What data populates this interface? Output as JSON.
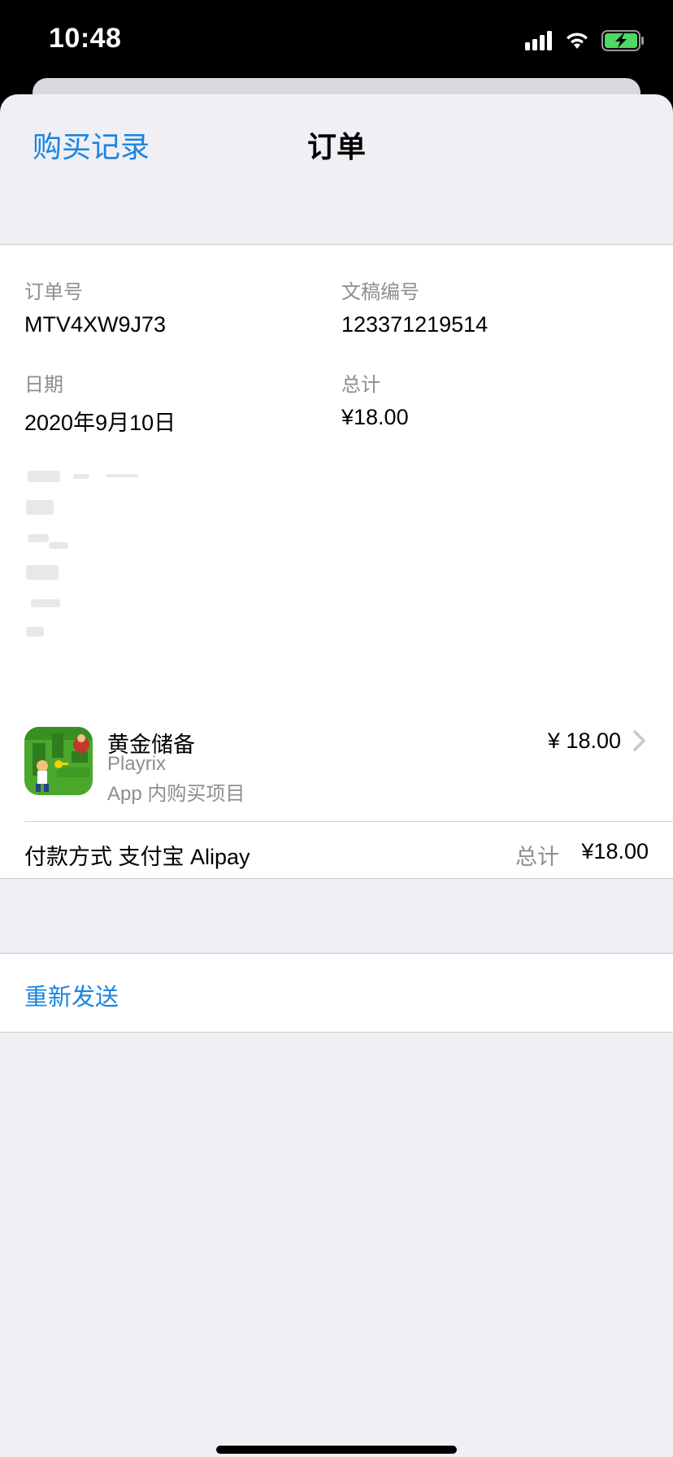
{
  "status_bar": {
    "time": "10:48",
    "icons": [
      "signal-icon",
      "wifi-icon",
      "battery-charging-icon"
    ],
    "battery_color": "#4cd964"
  },
  "nav": {
    "back_label": "购买记录",
    "title": "订单"
  },
  "order": {
    "order_no_label": "订单号",
    "order_no": "MTV4XW9J73",
    "doc_no_label": "文稿编号",
    "doc_no": "123371219514",
    "date_label": "日期",
    "date": "2020年9月10日",
    "total_label": "总计",
    "total": "¥18.00"
  },
  "item": {
    "name": "黄金储备",
    "developer": "Playrix",
    "type": "App 内购买项目",
    "price": "¥ 18.00",
    "icon": "game-app-icon"
  },
  "payment": {
    "method": "付款方式 支付宝 Alipay",
    "total_label": "总计",
    "total": "¥18.00"
  },
  "actions": {
    "resend_label": "重新发送"
  },
  "colors": {
    "accent": "#1a84e0",
    "background": "#efeff4",
    "secondary_text": "#8e8e93"
  }
}
